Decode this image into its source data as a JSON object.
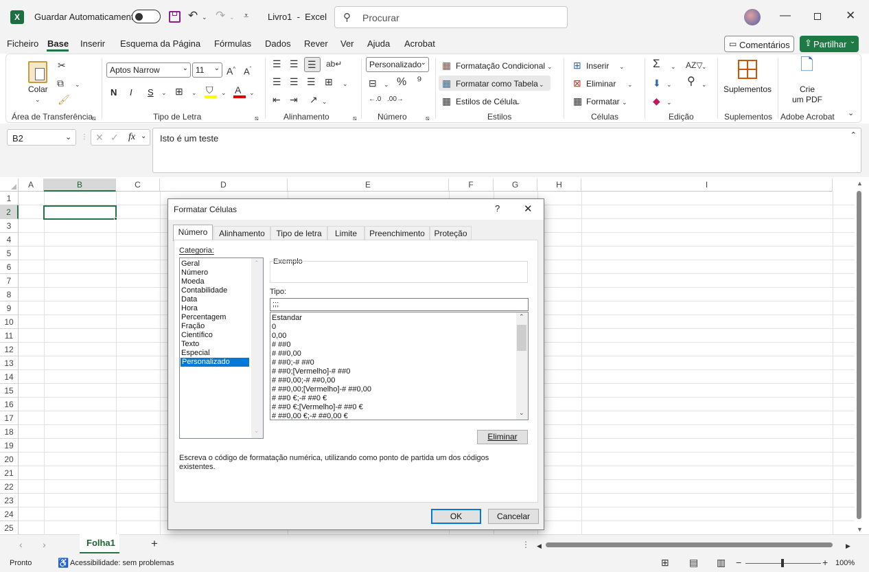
{
  "titlebar": {
    "autosave_label": "Guardar Automaticamente",
    "doc_title": "Livro1  -  Excel",
    "search_placeholder": "Procurar"
  },
  "menu": [
    "Ficheiro",
    "Base",
    "Inserir",
    "Esquema da Página",
    "Fórmulas",
    "Dados",
    "Rever",
    "Ver",
    "Ajuda",
    "Acrobat"
  ],
  "actions": {
    "comments": "Comentários",
    "share": "Partilhar"
  },
  "ribbon": {
    "clipboard": {
      "paste": "Colar",
      "group": "Área de Transferência"
    },
    "font": {
      "name": "Aptos Narrow",
      "size": "11",
      "bold": "N",
      "italic": "I",
      "underline": "S",
      "group": "Tipo de Letra"
    },
    "alignment": {
      "group": "Alinhamento"
    },
    "number": {
      "format": "Personalizado",
      "group": "Número"
    },
    "styles": {
      "conditional": "Formatação Condicional",
      "as_table": "Formatar como Tabela",
      "cell_styles": "Estilos de Célula",
      "group": "Estilos"
    },
    "cells": {
      "insert": "Inserir",
      "delete": "Eliminar",
      "format": "Formatar",
      "group": "Células"
    },
    "editing": {
      "group": "Edição"
    },
    "addins": {
      "label": "Suplementos",
      "group": "Suplementos"
    },
    "acrobat": {
      "label1": "Crie",
      "label2": "um PDF",
      "group": "Adobe Acrobat"
    }
  },
  "formula_bar": {
    "name_box": "B2",
    "content": "Isto é um teste"
  },
  "columns": [
    "A",
    "B",
    "C",
    "D",
    "E",
    "F",
    "G",
    "H",
    "I"
  ],
  "rows": [
    "1",
    "2",
    "3",
    "4",
    "5",
    "6",
    "7",
    "8",
    "9",
    "10",
    "11",
    "12",
    "13",
    "14",
    "15",
    "16",
    "17",
    "18",
    "19",
    "20",
    "21",
    "22",
    "23",
    "24",
    "25"
  ],
  "sheet_tab": "Folha1",
  "status": {
    "ready": "Pronto",
    "accessibility": "Acessibilidade: sem problemas",
    "zoom": "100%"
  },
  "dialog": {
    "title": "Formatar Células",
    "tabs": [
      "Número",
      "Alinhamento",
      "Tipo de letra",
      "Limite",
      "Preenchimento",
      "Proteção"
    ],
    "category_label": "Categoria:",
    "categories": [
      "Geral",
      "Número",
      "Moeda",
      "Contabilidade",
      "Data",
      "Hora",
      "Percentagem",
      "Fração",
      "Científico",
      "Texto",
      "Especial",
      "Personalizado"
    ],
    "selected_category": "Personalizado",
    "sample_label": "Exemplo",
    "type_label": "Tipo:",
    "type_value": ";;;",
    "type_list": [
      "Estandar",
      "0",
      "0,00",
      "# ##0",
      "# ##0,00",
      "# ##0;-# ##0",
      "# ##0;[Vermelho]-# ##0",
      "# ##0,00;-# ##0,00",
      "# ##0,00;[Vermelho]-# ##0,00",
      "# ##0 €;-# ##0 €",
      "# ##0 €;[Vermelho]-# ##0 €",
      "# ##0,00 €;-# ##0,00 €"
    ],
    "delete_button": "Eliminar",
    "description": "Escreva o código de formatação numérica, utilizando como ponto de partida um dos códigos existentes.",
    "ok": "OK",
    "cancel": "Cancelar",
    "help": "?",
    "close": "✕"
  },
  "colors": {
    "excel_green": "#217346",
    "share_green": "#1e7a45",
    "selection_blue": "#0078d7"
  }
}
